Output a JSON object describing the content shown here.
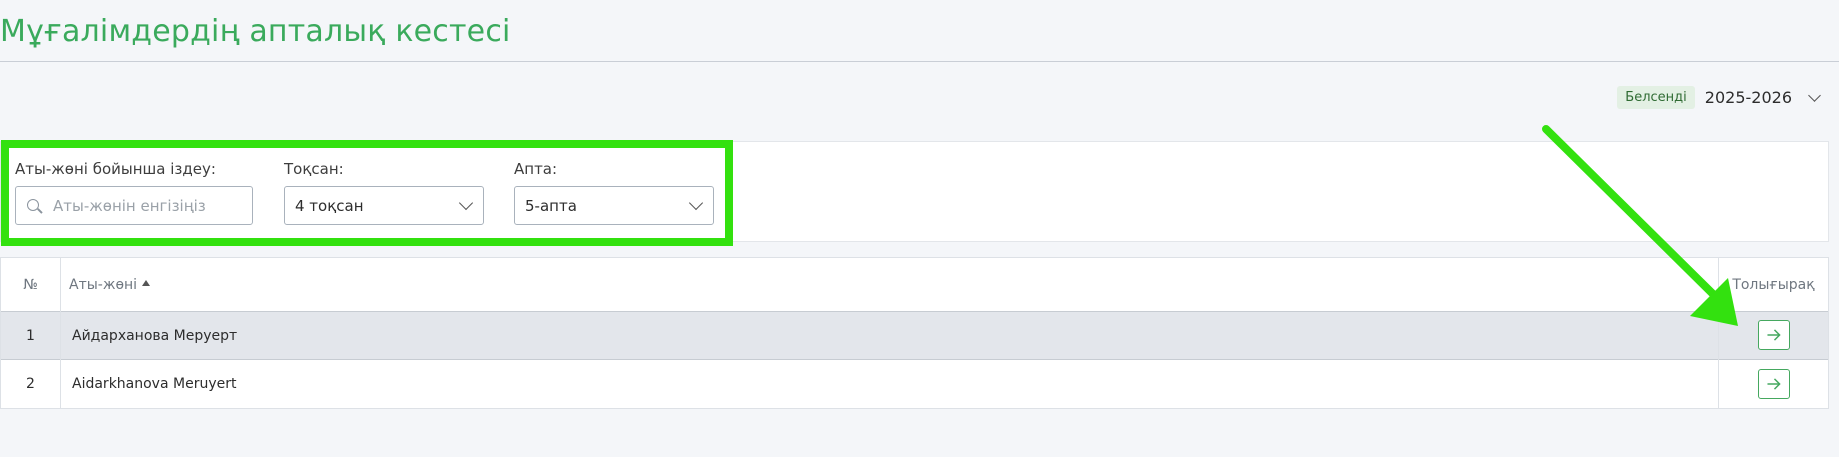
{
  "page": {
    "title": "Мұғалімдердің апталық кестесі"
  },
  "year_selector": {
    "status": "Белсенді",
    "year": "2025-2026"
  },
  "filters": {
    "search": {
      "label": "Аты-жөні бойынша іздеу:",
      "placeholder": "Аты-жөнін енгізіңіз",
      "value": ""
    },
    "quarter": {
      "label": "Тоқсан:",
      "selected": "4 тоқсан"
    },
    "week": {
      "label": "Апта:",
      "selected": "5-апта"
    }
  },
  "table": {
    "headers": {
      "number": "№",
      "name": "Аты-жөні",
      "details": "Толығырақ"
    },
    "rows": [
      {
        "number": "1",
        "name": "Айдарханова Меруерт"
      },
      {
        "number": "2",
        "name": "Aidarkhanova Meruyert"
      }
    ]
  },
  "colors": {
    "accent": "#3aaa5c",
    "annotation": "#33e10f",
    "status_badge_bg": "#e3f0e4"
  },
  "icons": {
    "search": "search-icon",
    "year_dropdown": "chevron-down-icon",
    "select_dropdown": "chevron-down-icon",
    "sort": "sort-ascending-icon",
    "details": "arrow-right-icon"
  }
}
